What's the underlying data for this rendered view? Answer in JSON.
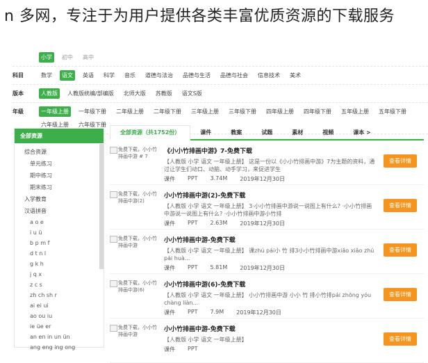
{
  "page_title": "n 多网，专注于为用户提供各类丰富优质资源的下载服务",
  "filters": [
    {
      "label": "",
      "options": [
        {
          "text": "小学",
          "selected": true
        },
        {
          "text": "初中",
          "selected": false,
          "dim": true
        },
        {
          "text": "高中",
          "selected": false,
          "dim": true
        }
      ]
    },
    {
      "label": "科目",
      "options": [
        {
          "text": "数学"
        },
        {
          "text": "语文",
          "selected": true
        },
        {
          "text": "英语"
        },
        {
          "text": "科学"
        },
        {
          "text": "音乐"
        },
        {
          "text": "道德与法治"
        },
        {
          "text": "品德与生活"
        },
        {
          "text": "品德与社会"
        },
        {
          "text": "信息技术"
        },
        {
          "text": "美术"
        }
      ]
    },
    {
      "label": "版本",
      "options": [
        {
          "text": "人教版",
          "selected": true
        },
        {
          "text": "人教版统编/部编版"
        },
        {
          "text": "北师大版"
        },
        {
          "text": "苏教版"
        },
        {
          "text": "语文S版"
        }
      ]
    },
    {
      "label": "年级",
      "options": [
        {
          "text": "一年级上册",
          "selected": true
        },
        {
          "text": "一年级下册"
        },
        {
          "text": "二年级上册"
        },
        {
          "text": "二年级下册"
        },
        {
          "text": "三年级上册"
        },
        {
          "text": "三年级下册"
        },
        {
          "text": "四年级上册"
        },
        {
          "text": "四年级下册"
        },
        {
          "text": "五年级上册"
        },
        {
          "text": "五年级下册"
        },
        {
          "text": "六年级上册"
        },
        {
          "text": "六年级下册"
        }
      ]
    }
  ],
  "sidebar": {
    "header": "全部资源",
    "items": [
      {
        "text": "综合资源",
        "level": "l1"
      },
      {
        "text": "单元练习",
        "level": "l2"
      },
      {
        "text": "期中练习",
        "level": "l2"
      },
      {
        "text": "期末练习",
        "level": "l2"
      },
      {
        "text": "入学教育",
        "level": "l1"
      },
      {
        "text": "汉语拼音",
        "level": "l1"
      },
      {
        "text": "a o e",
        "level": "l3"
      },
      {
        "text": "i u ü",
        "level": "l3"
      },
      {
        "text": "b p m f",
        "level": "l3"
      },
      {
        "text": "d t n l",
        "level": "l3"
      },
      {
        "text": "g k h",
        "level": "l3"
      },
      {
        "text": "j q x",
        "level": "l3"
      },
      {
        "text": "z c s",
        "level": "l3"
      },
      {
        "text": "zh ch sh r",
        "level": "l3"
      },
      {
        "text": "ai ei ui",
        "level": "l3"
      },
      {
        "text": "ao ou iu",
        "level": "l3"
      },
      {
        "text": "ie üe er",
        "level": "l3"
      },
      {
        "text": "an en in un ün",
        "level": "l3"
      },
      {
        "text": "ang eng ing ong",
        "level": "l3"
      }
    ]
  },
  "tabs": [
    {
      "text": "全部资源（共1752份）",
      "selected": true
    },
    {
      "text": "课件"
    },
    {
      "text": "教案"
    },
    {
      "text": "试题"
    },
    {
      "text": "素材"
    },
    {
      "text": "视频"
    },
    {
      "text": "课本 >"
    }
  ],
  "items": [
    {
      "thumb": "免费下载，小小竹排画中游 # 7",
      "title": "《小小竹排画中游》7-免费下载",
      "desc": "【人教版 小学 语文 一年级上册】 这是一份以《小小竹排画中游》7为主题的资料，通过让学生们动口、动脑、动手学习，来促进学生",
      "type": "课件",
      "format": "PPT",
      "size": "3.74M",
      "date": "2019年12月30日",
      "button": "查看详情"
    },
    {
      "thumb": "免费下载，小小竹排画中游(2)",
      "title": "小小竹排画中游(2)-免费下载",
      "desc": "【人教版 小学 语文 一年级上册】 3·小小竹排画中游说一说图上有什么? ·小小竹排画中游说一说图上有什么? ·小小竹排画中游小竹排",
      "type": "课件",
      "format": "PPT",
      "size": "2.63M",
      "date": "2019年12月30日",
      "button": "查看详情"
    },
    {
      "thumb": "免费下载，小小竹排画中游",
      "title": "小小竹排画中游-免费下载",
      "desc": "【人教版 小学 语文 一年级上册】 课zhú pái小 竹 排3小小竹排画中游xiǎo xiǎo zhú pái huà...",
      "type": "课件",
      "format": "PPT",
      "size": "5.81M",
      "date": "2019年12月30日",
      "button": "查看详情"
    },
    {
      "thumb": "免费下载，小小竹排画中游(6)",
      "title": "小小竹排画中游(6)-免费下载",
      "desc": "【人教版 小学 语文 一年级上册】 小小竹排画中游 小小 竹 排小竹排pái zhōng yóu chàng liàn...",
      "type": "课件",
      "format": "PPT",
      "size": "7.9M",
      "date": "2019年12月30日",
      "button": "查看详情"
    },
    {
      "thumb": "免费下载，小小竹排画中游",
      "title": "小小竹排画中游-免费下载",
      "desc": "【人教版 小学 语文 一年级上册】",
      "type": "课件",
      "format": "PPT",
      "size": "",
      "date": "",
      "button": "查看详情"
    }
  ]
}
